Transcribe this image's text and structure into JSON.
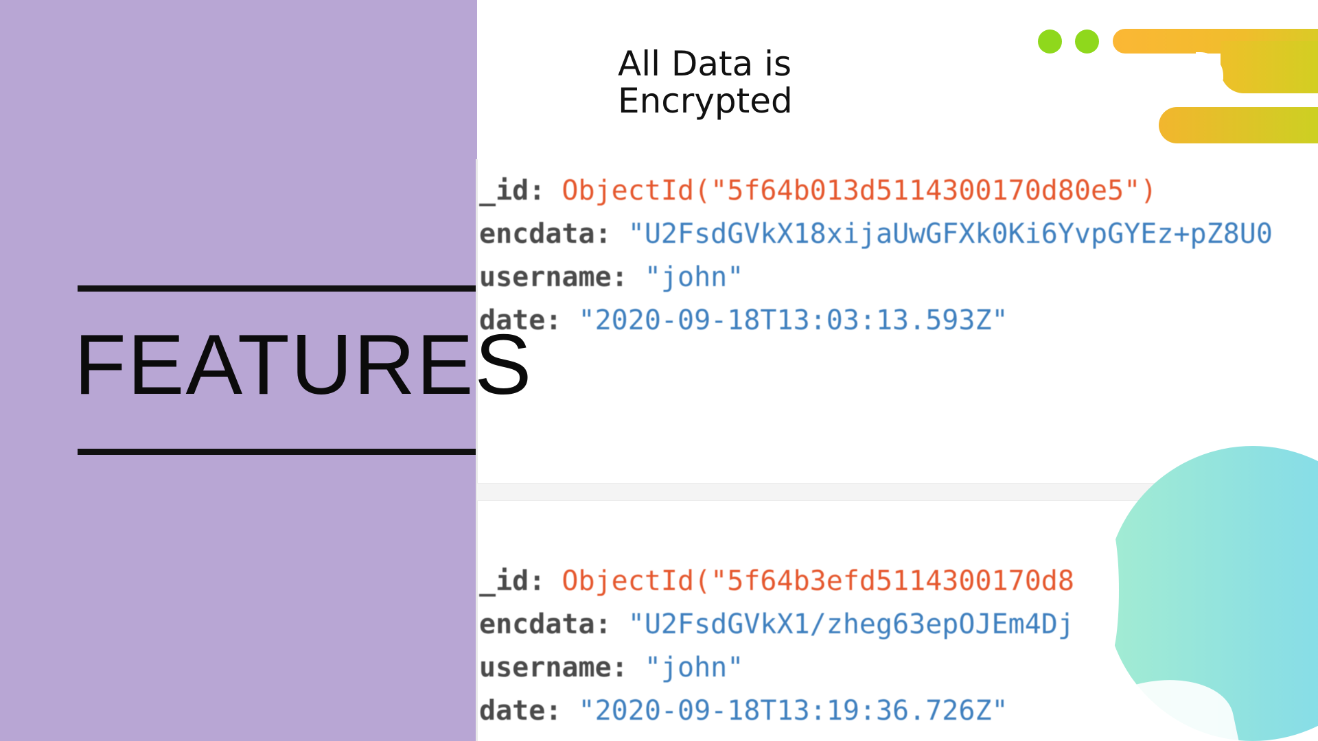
{
  "slide": {
    "title": "FEATURES",
    "headline": {
      "line1": "All Data is",
      "line2": "Encrypted"
    }
  },
  "records": [
    {
      "id_key": "_id",
      "id_value": "ObjectId(\"5f64b013d5114300170d80e5\")",
      "encdata_key": "encdata",
      "encdata_value": "\"U2FsdGVkX18xijaUwGFXk0Ki6YvpGYEz+pZ8U0",
      "username_key": "username",
      "username_value": "\"john\"",
      "date_key": "date",
      "date_value": "\"2020-09-18T13:03:13.593Z\""
    },
    {
      "id_key": "_id",
      "id_value": "ObjectId(\"5f64b3efd5114300170d8",
      "encdata_key": "encdata",
      "encdata_value": "\"U2FsdGVkX1/zheg63epOJEm4Dj",
      "username_key": "username",
      "username_value": "\"john\"",
      "date_key": "date",
      "date_value": "\"2020-09-18T13:19:36.726Z\""
    }
  ],
  "colors": {
    "left_panel": "#b8a6d4",
    "key_text": "#4a4a4a",
    "object_id": "#e5572d",
    "string_value": "#3e7fbe",
    "dot_green": "#8fd81c",
    "bar_orange": "#fbb735",
    "blob_teal": "#8de0e2"
  }
}
